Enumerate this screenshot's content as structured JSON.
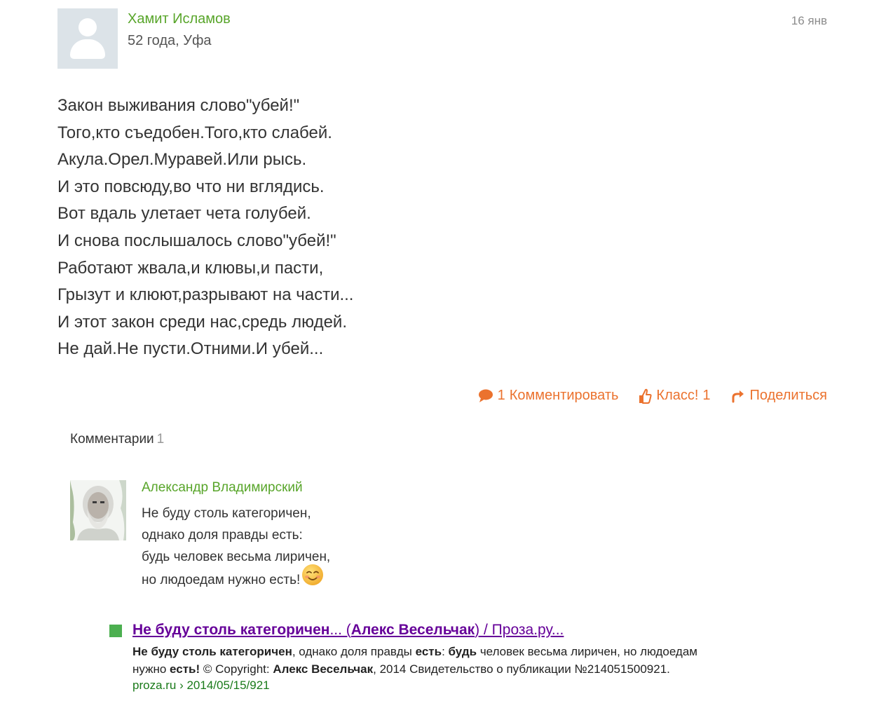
{
  "post": {
    "author": "Хамит Исламов",
    "meta": "52 года, Уфа",
    "date": "16 янв",
    "lines": [
      "Закон выживания слово\"убей!\"",
      "Того,кто съедобен.Того,кто слабей.",
      "Акула.Орел.Муравей.Или рысь.",
      "И это повсюду,во что ни вглядись.",
      "Вот вдаль улетает чета голубей.",
      "И снова послышалось слово\"убей!\"",
      "Работают жвала,и клювы,и пасти,",
      "Грызут и клюют,разрывают на части...",
      "И этот закон среди нас,средь людей.",
      "Не дай.Не пусти.Отними.И убей..."
    ]
  },
  "actions": {
    "comment_count": "1",
    "comment_label": "Комментировать",
    "like_label": "Класс!",
    "like_count": "1",
    "share_label": "Поделиться",
    "accent_color": "#eb722e"
  },
  "comments": {
    "heading": "Комментарии",
    "count": "1",
    "items": [
      {
        "author": "Александр Владимирский",
        "lines": [
          "Не буду столь категоричен,",
          "однако доля правды есть:",
          "будь человек весьма лиричен,",
          "но людоедам нужно есть!"
        ],
        "emoji": "smiling-face-icon"
      }
    ]
  },
  "search_result": {
    "title_bold": "Не буду столь категоричен",
    "title_mid": "... (",
    "title_author": "Алекс Весельчак",
    "title_tail": ") / Проза.ру...",
    "snippet": {
      "s1": "Не буду столь категоричен",
      "s2": ", однако доля правды ",
      "s3": "есть",
      "s4": ": ",
      "s5": "будь",
      "s6": " человек весьма лиричен, но людоедам",
      "s7": "нужно ",
      "s8": "есть!",
      "s9": " © Copyright: ",
      "s10": "Алекс Весельчак",
      "s11": ", 2014 Свидетельство о публикации №214051500921."
    },
    "url": "proza.ru › 2014/05/15/921"
  },
  "colors": {
    "link_green": "#58a52a",
    "visited_link": "#660099",
    "url_green": "#1a7a1a"
  }
}
